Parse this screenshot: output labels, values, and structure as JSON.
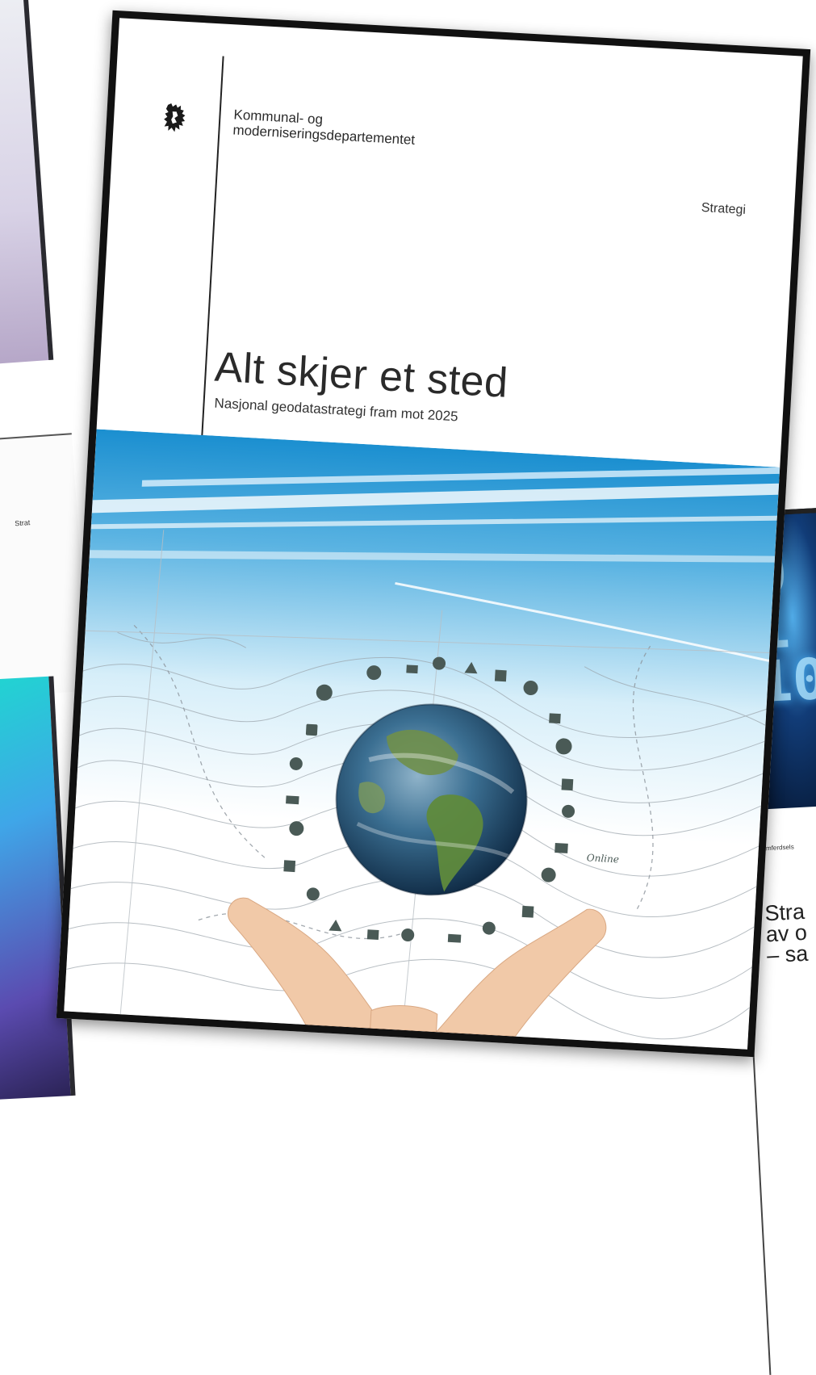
{
  "background_docs": {
    "left_mid_label": "Strat",
    "right_neon_digits": "0\n1\n10",
    "right_doc_dept": "Samferdsels",
    "right_doc_title_lines": [
      "Stra",
      "av o",
      "– sa"
    ]
  },
  "cover": {
    "department_line1": "Kommunal- og",
    "department_line2": "moderniseringsdepartementet",
    "document_type": "Strategi",
    "title": "Alt skjer et sted",
    "subtitle": "Nasjonal geodatastrategi fram mot 2025",
    "globe_note": "Online",
    "logo_icon": "norwegian-lion-coat-of-arms-icon",
    "colors": {
      "sky_blue": "#1b8fd0",
      "light_blue": "#bfe3f6",
      "frame": "#111111"
    }
  }
}
